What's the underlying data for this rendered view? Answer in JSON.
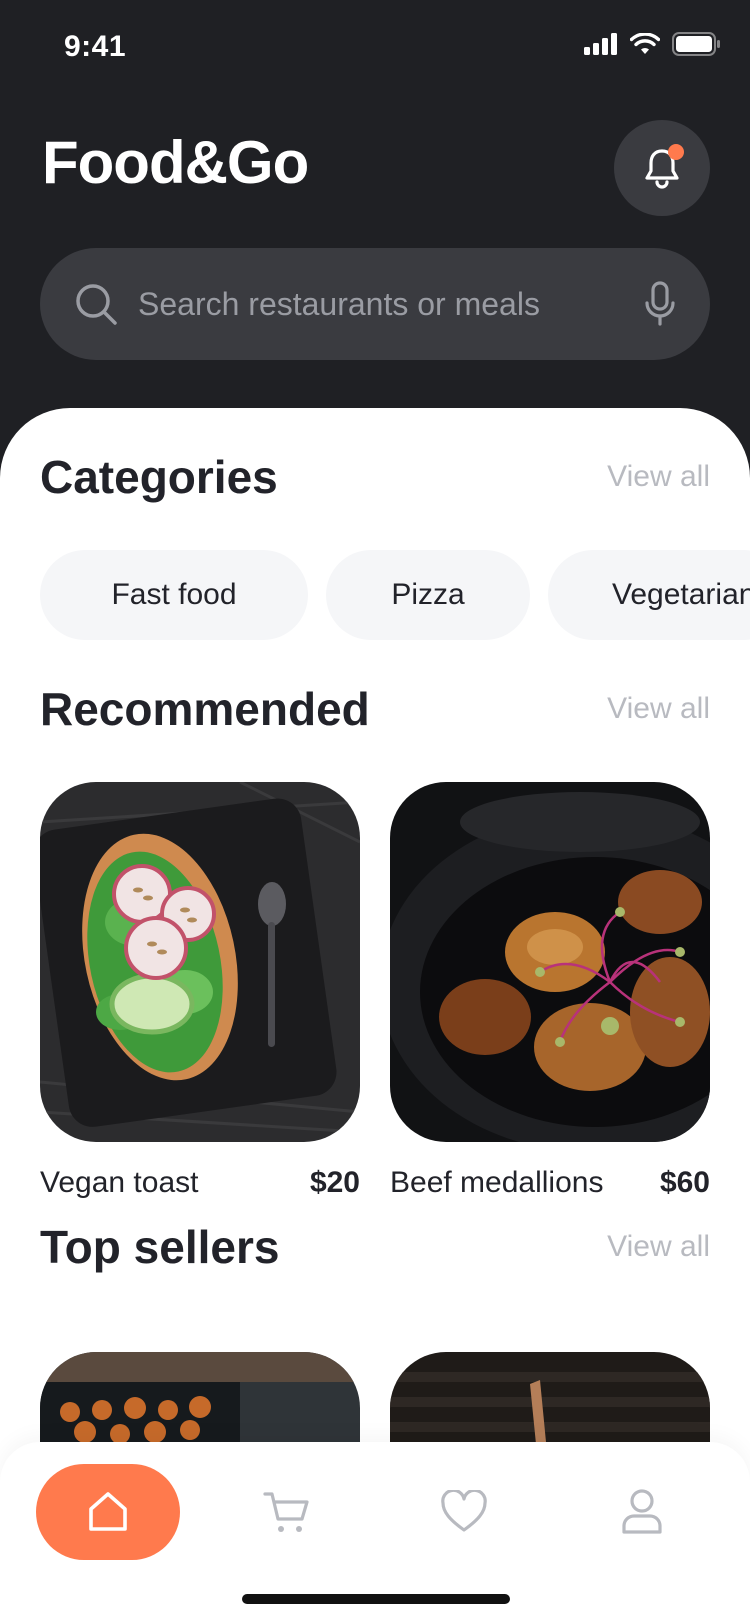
{
  "status": {
    "time": "9:41"
  },
  "header": {
    "title": "Food&Go",
    "has_notification": true
  },
  "search": {
    "placeholder": "Search restaurants or meals"
  },
  "sections": {
    "categories": {
      "title": "Categories",
      "view_all": "View all"
    },
    "recommended": {
      "title": "Recommended",
      "view_all": "View all"
    },
    "top_sellers": {
      "title": "Top sellers",
      "view_all": "View all"
    }
  },
  "categories": [
    "Fast food",
    "Pizza",
    "Vegetarian"
  ],
  "recommended": [
    {
      "name": "Vegan toast",
      "price": "$20"
    },
    {
      "name": "Beef medallions",
      "price": "$60"
    }
  ],
  "tabs": [
    "home",
    "cart",
    "favorites",
    "profile"
  ],
  "colors": {
    "accent": "#ff7a4d",
    "dark": "#1f2024",
    "muted": "#b8bac0"
  }
}
